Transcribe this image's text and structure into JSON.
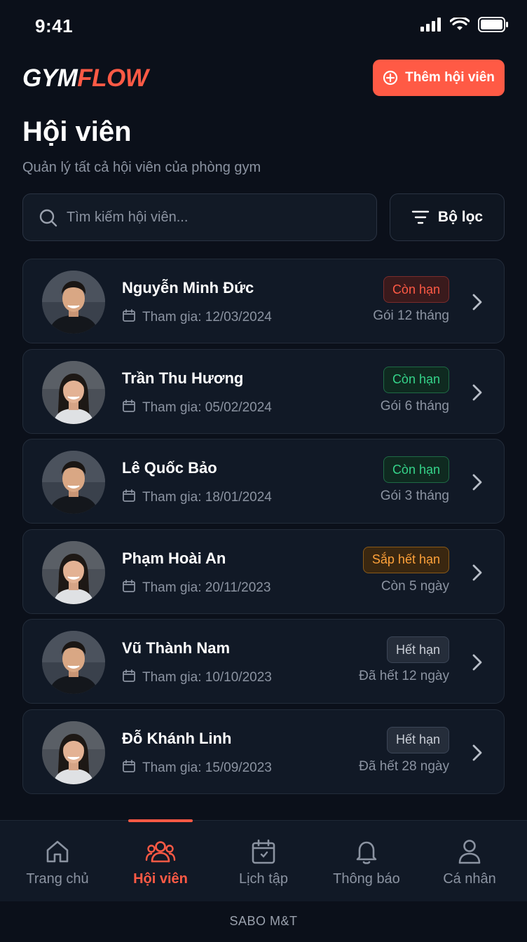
{
  "status_bar": {
    "time": "9:41"
  },
  "header": {
    "logo_part1": "GYM",
    "logo_part2": "FLOW",
    "add_button_label": "Thêm hội viên"
  },
  "page": {
    "title": "Hội viên",
    "subtitle": "Quản lý tất cả hội viên của phòng gym"
  },
  "search": {
    "placeholder": "Tìm kiếm hội viên..."
  },
  "filter": {
    "label": "Bộ lọc"
  },
  "members": [
    {
      "name": "Nguyễn Minh Đức",
      "join": "Tham gia: 12/03/2024",
      "status": "Còn hạn",
      "status_color": "red",
      "plan": "Gói 12 tháng",
      "avatar": "male"
    },
    {
      "name": "Trần Thu Hương",
      "join": "Tham gia: 05/02/2024",
      "status": "Còn hạn",
      "status_color": "green",
      "plan": "Gói 6 tháng",
      "avatar": "female"
    },
    {
      "name": "Lê Quốc Bảo",
      "join": "Tham gia: 18/01/2024",
      "status": "Còn hạn",
      "status_color": "green",
      "plan": "Gói 3 tháng",
      "avatar": "male"
    },
    {
      "name": "Phạm Hoài An",
      "join": "Tham gia: 20/11/2023",
      "status": "Sắp hết hạn",
      "status_color": "orange",
      "plan": "Còn 5 ngày",
      "avatar": "female"
    },
    {
      "name": "Vũ Thành Nam",
      "join": "Tham gia: 10/10/2023",
      "status": "Hết hạn",
      "status_color": "gray",
      "plan": "Đã hết 12 ngày",
      "avatar": "male"
    },
    {
      "name": "Đỗ Khánh Linh",
      "join": "Tham gia: 15/09/2023",
      "status": "Hết hạn",
      "status_color": "gray",
      "plan": "Đã hết 28 ngày",
      "avatar": "female"
    }
  ],
  "bottom_nav": {
    "items": [
      {
        "label": "Trang chủ",
        "icon": "home-icon",
        "active": false
      },
      {
        "label": "Hội viên",
        "icon": "users-icon",
        "active": true
      },
      {
        "label": "Lịch tập",
        "icon": "calendar-icon",
        "active": false
      },
      {
        "label": "Thông báo",
        "icon": "bell-icon",
        "active": false
      },
      {
        "label": "Cá nhân",
        "icon": "user-icon",
        "active": false
      }
    ]
  },
  "footer": {
    "text": "SABO M&T"
  },
  "colors": {
    "accent": "#ff5a45",
    "background": "#0b101a",
    "card": "#111926",
    "green": "#35d48a",
    "orange": "#ffa23a"
  }
}
